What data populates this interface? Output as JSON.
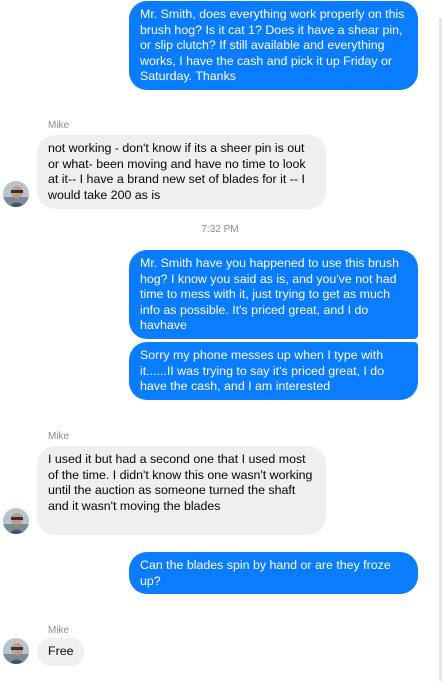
{
  "thread": {
    "messages": [
      {
        "from": "me",
        "text": "Mr. Smith,  does everything work properly on this brush hog?  Is it cat 1? Does it have a shear pin, or slip clutch?  If still available and everything works, I have the cash and pick it up Friday or Saturday.    Thanks"
      },
      {
        "from": "them",
        "sender": "Mike",
        "text": "not working - don't know if its a sheer pin is out or what-  been moving and have no time to look at it-- I have a brand new set of blades for it -- I would take 200 as is"
      },
      {
        "type": "timestamp",
        "text": "7:32 PM"
      },
      {
        "from": "me",
        "text": "Mr. Smith have you happened to use this brush hog?  I know you said as is, and you've not had time to mess with it, just trying to get as much info as possible.  It's priced great, and I do havhave"
      },
      {
        "from": "me",
        "text": "Sorry my phone messes up when I type with it......II was trying to say it's priced great, I do have the cash, and I am interested"
      },
      {
        "from": "them",
        "sender": "Mike",
        "text": "I used it but had a second one that I  used most of the time.  I didn't know this one wasn't working until the auction as someone turned the shaft and it wasn't moving the blades"
      },
      {
        "from": "me",
        "text": "Can the blades spin by hand or are they froze up?"
      },
      {
        "from": "them",
        "sender": "Mike",
        "text": "Free"
      }
    ]
  },
  "colors": {
    "outgoing_bubble": "#0a7cff",
    "incoming_bubble": "#efefef",
    "meta_text": "#8a8d91"
  },
  "icons": {
    "avatar": "contact-avatar-photo"
  }
}
